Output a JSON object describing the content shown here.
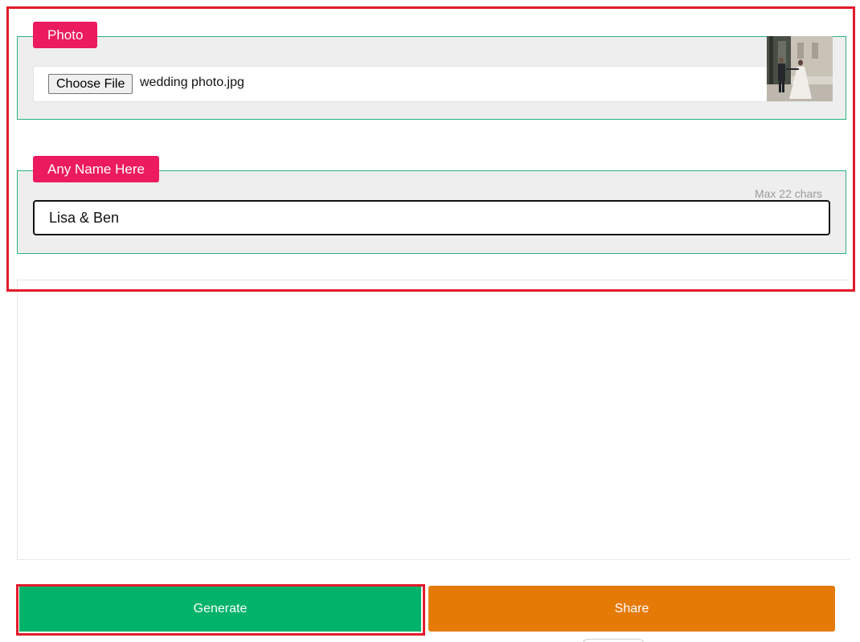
{
  "photo_section": {
    "legend": "Photo",
    "choose_file_label": "Choose File",
    "file_name": "wedding photo.jpg"
  },
  "name_section": {
    "legend": "Any Name Here",
    "hint": "Max 22 chars",
    "value": "Lisa & Ben"
  },
  "actions": {
    "generate_label": "Generate",
    "share_label": "Share"
  },
  "colors": {
    "legend_bg": "#ec1a5e",
    "fieldset_border": "#2bb27a",
    "generate_bg": "#00b26a",
    "share_bg": "#e57a07",
    "highlight": "#e21b2c"
  }
}
